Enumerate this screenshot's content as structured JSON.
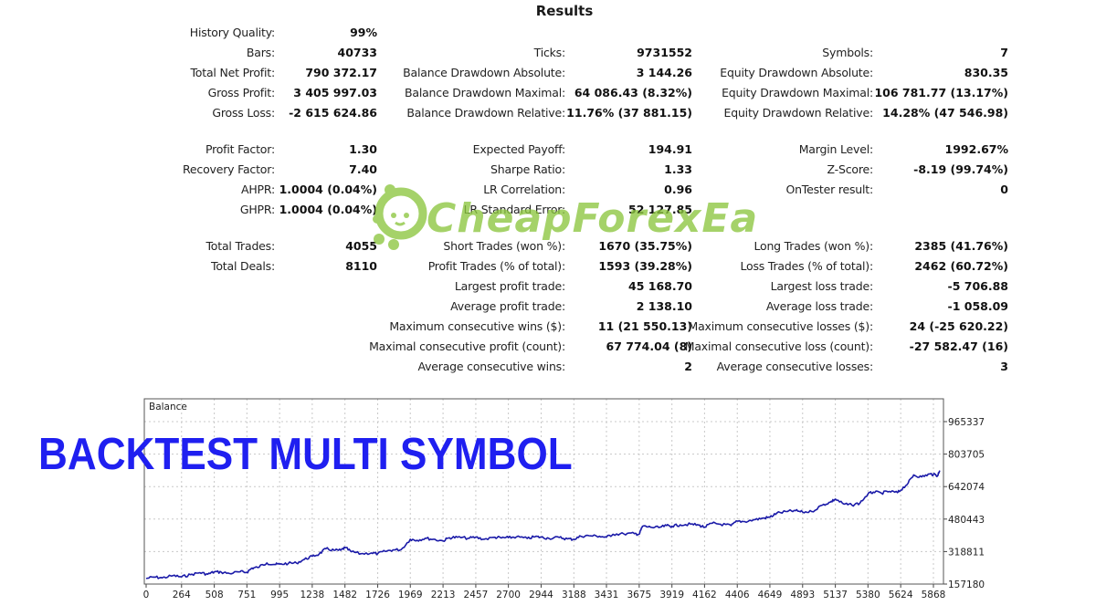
{
  "title": "Results",
  "stats": {
    "history_quality": {
      "label": "History Quality:",
      "value": "99%"
    },
    "bars": {
      "label": "Bars:",
      "value": "40733"
    },
    "ticks": {
      "label": "Ticks:",
      "value": "9731552"
    },
    "symbols": {
      "label": "Symbols:",
      "value": "7"
    },
    "total_net_profit": {
      "label": "Total Net Profit:",
      "value": "790 372.17"
    },
    "gross_profit": {
      "label": "Gross Profit:",
      "value": "3 405 997.03"
    },
    "gross_loss": {
      "label": "Gross Loss:",
      "value": "-2 615 624.86"
    },
    "balance_dd_abs": {
      "label": "Balance Drawdown Absolute:",
      "value": "3 144.26"
    },
    "balance_dd_max": {
      "label": "Balance Drawdown Maximal:",
      "value": "64 086.43 (8.32%)"
    },
    "balance_dd_rel": {
      "label": "Balance Drawdown Relative:",
      "value": "11.76% (37 881.15)"
    },
    "equity_dd_abs": {
      "label": "Equity Drawdown Absolute:",
      "value": "830.35"
    },
    "equity_dd_max": {
      "label": "Equity Drawdown Maximal:",
      "value": "106 781.77 (13.17%)"
    },
    "equity_dd_rel": {
      "label": "Equity Drawdown Relative:",
      "value": "14.28% (47 546.98)"
    },
    "profit_factor": {
      "label": "Profit Factor:",
      "value": "1.30"
    },
    "recovery_factor": {
      "label": "Recovery Factor:",
      "value": "7.40"
    },
    "ahpr": {
      "label": "AHPR:",
      "value": "1.0004 (0.04%)"
    },
    "ghpr": {
      "label": "GHPR:",
      "value": "1.0004 (0.04%)"
    },
    "expected_payoff": {
      "label": "Expected Payoff:",
      "value": "194.91"
    },
    "sharpe_ratio": {
      "label": "Sharpe Ratio:",
      "value": "1.33"
    },
    "lr_correlation": {
      "label": "LR Correlation:",
      "value": "0.96"
    },
    "lr_std_error": {
      "label": "LR Standard Error:",
      "value": "52 127.85"
    },
    "margin_level": {
      "label": "Margin Level:",
      "value": "1992.67%"
    },
    "z_score": {
      "label": "Z-Score:",
      "value": "-8.19 (99.74%)"
    },
    "ontester": {
      "label": "OnTester result:",
      "value": "0"
    },
    "total_trades": {
      "label": "Total Trades:",
      "value": "4055"
    },
    "total_deals": {
      "label": "Total Deals:",
      "value": "8110"
    },
    "short_trades": {
      "label": "Short Trades (won %):",
      "value": "1670 (35.75%)"
    },
    "profit_trades": {
      "label": "Profit Trades (% of total):",
      "value": "1593 (39.28%)"
    },
    "largest_profit": {
      "label": "Largest profit trade:",
      "value": "45 168.70"
    },
    "avg_profit": {
      "label": "Average profit trade:",
      "value": "2 138.10"
    },
    "max_consec_wins": {
      "label": "Maximum consecutive wins ($):",
      "value": "11 (21 550.13)"
    },
    "maximal_consec_profit": {
      "label": "Maximal consecutive profit (count):",
      "value": "67 774.04 (8)"
    },
    "avg_consec_wins": {
      "label": "Average consecutive wins:",
      "value": "2"
    },
    "long_trades": {
      "label": "Long Trades (won %):",
      "value": "2385 (41.76%)"
    },
    "loss_trades": {
      "label": "Loss Trades (% of total):",
      "value": "2462 (60.72%)"
    },
    "largest_loss": {
      "label": "Largest loss trade:",
      "value": "-5 706.88"
    },
    "avg_loss": {
      "label": "Average loss trade:",
      "value": "-1 058.09"
    },
    "max_consec_losses": {
      "label": "Maximum consecutive losses ($):",
      "value": "24 (-25 620.22)"
    },
    "maximal_consec_loss": {
      "label": "Maximal consecutive loss (count):",
      "value": "-27 582.47 (16)"
    },
    "avg_consec_losses": {
      "label": "Average consecutive losses:",
      "value": "3"
    }
  },
  "watermark": {
    "text": "CheapForexEa",
    "color": "#8cc63f"
  },
  "banner": {
    "text": "BACKTEST MULTI SYMBOL",
    "color": "#1f1ff0"
  },
  "chart_data": {
    "type": "line",
    "title": "Balance",
    "xlabel": "",
    "ylabel": "",
    "x_ticks": [
      0,
      264,
      508,
      751,
      995,
      1238,
      1482,
      1726,
      1969,
      2213,
      2457,
      2700,
      2944,
      3188,
      3431,
      3675,
      3919,
      4162,
      4406,
      4649,
      4893,
      5137,
      5380,
      5624,
      5868
    ],
    "y_ticks": [
      157180,
      318811,
      480443,
      642074,
      803705,
      965337
    ],
    "xlim": [
      0,
      5920
    ],
    "ylim": [
      157180,
      1045000
    ],
    "grid": true,
    "line_color": "#1a1aa8",
    "series": [
      {
        "name": "Balance",
        "x": [
          0,
          60,
          120,
          200,
          264,
          330,
          400,
          460,
          508,
          560,
          620,
          700,
          751,
          790,
          830,
          900,
          960,
          995,
          1060,
          1120,
          1180,
          1238,
          1290,
          1340,
          1400,
          1450,
          1482,
          1530,
          1600,
          1680,
          1726,
          1780,
          1840,
          1900,
          1969,
          2020,
          2080,
          2140,
          2213,
          2260,
          2320,
          2400,
          2457,
          2520,
          2600,
          2650,
          2700,
          2760,
          2840,
          2900,
          2944,
          3000,
          3080,
          3140,
          3188,
          3240,
          3300,
          3380,
          3431,
          3480,
          3560,
          3640,
          3675,
          3700,
          3760,
          3820,
          3880,
          3919,
          3980,
          4060,
          4120,
          4162,
          4220,
          4280,
          4360,
          4406,
          4460,
          4540,
          4600,
          4649,
          4700,
          4780,
          4840,
          4893,
          4960,
          5040,
          5100,
          5137,
          5200,
          5260,
          5320,
          5380,
          5420,
          5480,
          5540,
          5600,
          5624,
          5680,
          5720,
          5780,
          5840,
          5868,
          5900,
          5915
        ],
        "values": [
          185000,
          192000,
          188000,
          199000,
          193000,
          204000,
          214000,
          206000,
          218000,
          216000,
          210000,
          218000,
          216000,
          237000,
          240000,
          262000,
          255000,
          256000,
          260000,
          262000,
          280000,
          295000,
          307000,
          333000,
          325000,
          325000,
          338000,
          318000,
          308000,
          312000,
          308000,
          320000,
          327000,
          328000,
          380000,
          375000,
          385000,
          380000,
          372000,
          388000,
          390000,
          385000,
          390000,
          380000,
          390000,
          387000,
          388000,
          392000,
          384000,
          393000,
          390000,
          385000,
          389000,
          382000,
          380000,
          395000,
          398000,
          395000,
          390000,
          405000,
          407000,
          408000,
          405000,
          445000,
          440000,
          438000,
          448000,
          445000,
          452000,
          455000,
          450000,
          440000,
          460000,
          455000,
          448000,
          470000,
          468000,
          478000,
          485000,
          490000,
          510000,
          518000,
          522000,
          515000,
          518000,
          550000,
          565000,
          580000,
          555000,
          550000,
          560000,
          605000,
          615000,
          610000,
          618000,
          612000,
          625000,
          660000,
          700000,
          690000,
          705000,
          702000,
          698000,
          722000,
          722000
        ]
      }
    ]
  }
}
